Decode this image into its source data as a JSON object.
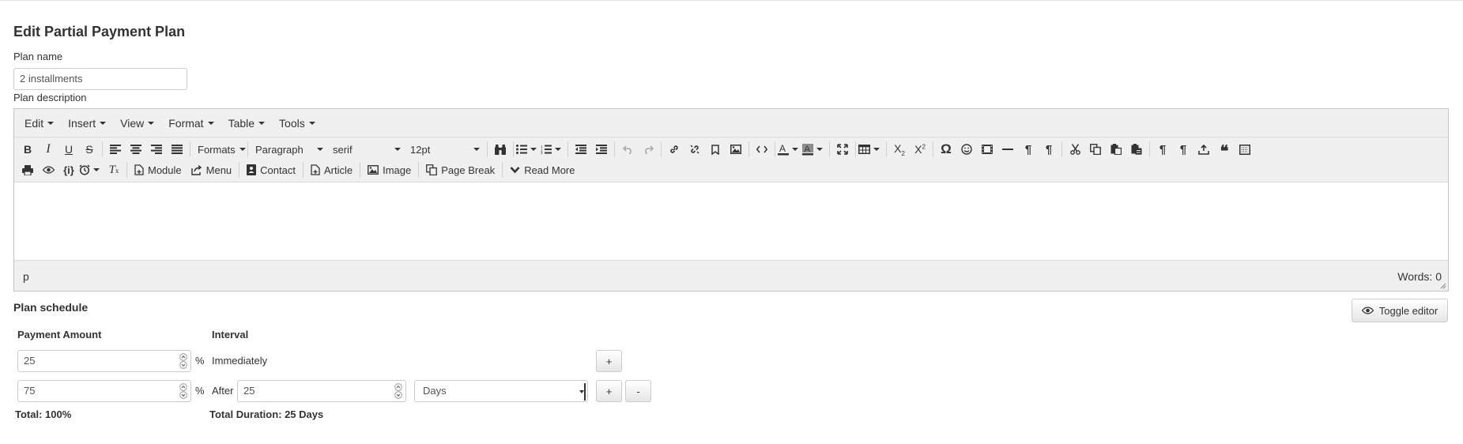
{
  "page": {
    "title": "Edit Partial Payment Plan"
  },
  "form": {
    "plan_name_label": "Plan name",
    "plan_name_value": "2 installments",
    "plan_description_label": "Plan description"
  },
  "editor": {
    "menus": [
      "Edit",
      "Insert",
      "View",
      "Format",
      "Table",
      "Tools"
    ],
    "formats_label": "Formats",
    "block_format": "Paragraph",
    "font_family": "serif",
    "font_size": "12pt",
    "buttons_row2": {
      "module": "Module",
      "menu": "Menu",
      "contact": "Contact",
      "article": "Article",
      "image": "Image",
      "page_break": "Page Break",
      "read_more": "Read More"
    },
    "icons_row1": [
      "bold-icon",
      "italic-icon",
      "underline-icon",
      "strikethrough-icon",
      "align-left-icon",
      "align-center-icon",
      "align-right-icon",
      "align-justify-icon",
      "search-replace-icon",
      "bullet-list-icon",
      "numbered-list-icon",
      "outdent-icon",
      "indent-icon",
      "undo-icon",
      "redo-icon",
      "link-icon",
      "unlink-icon",
      "bookmark-icon",
      "image-icon",
      "code-icon",
      "text-color-icon",
      "background-color-icon",
      "fullscreen-icon",
      "table-icon",
      "subscript-icon",
      "superscript-icon",
      "omega-icon",
      "emoticon-icon",
      "media-icon",
      "horizontal-rule-icon",
      "ltr-icon",
      "rtl-icon",
      "cut-icon",
      "copy-icon",
      "paste-icon",
      "paste-text-icon",
      "pilcrow-icon",
      "pilcrow-alt-icon",
      "upload-icon",
      "blockquote-icon",
      "template-icon"
    ],
    "status_path": "p",
    "word_count": "Words: 0"
  },
  "schedule": {
    "title": "Plan schedule",
    "toggle_editor_label": "Toggle editor",
    "col_amount": "Payment Amount",
    "col_interval": "Interval",
    "rows": [
      {
        "amount": "25",
        "unit": "%",
        "interval_text": "Immediately"
      },
      {
        "amount": "75",
        "unit": "%",
        "after_label": "After",
        "after_value": "25",
        "period": "Days"
      }
    ],
    "plus_label": "+",
    "minus_label": "-",
    "total": "Total: 100%",
    "total_duration": "Total Duration: 25 Days"
  }
}
